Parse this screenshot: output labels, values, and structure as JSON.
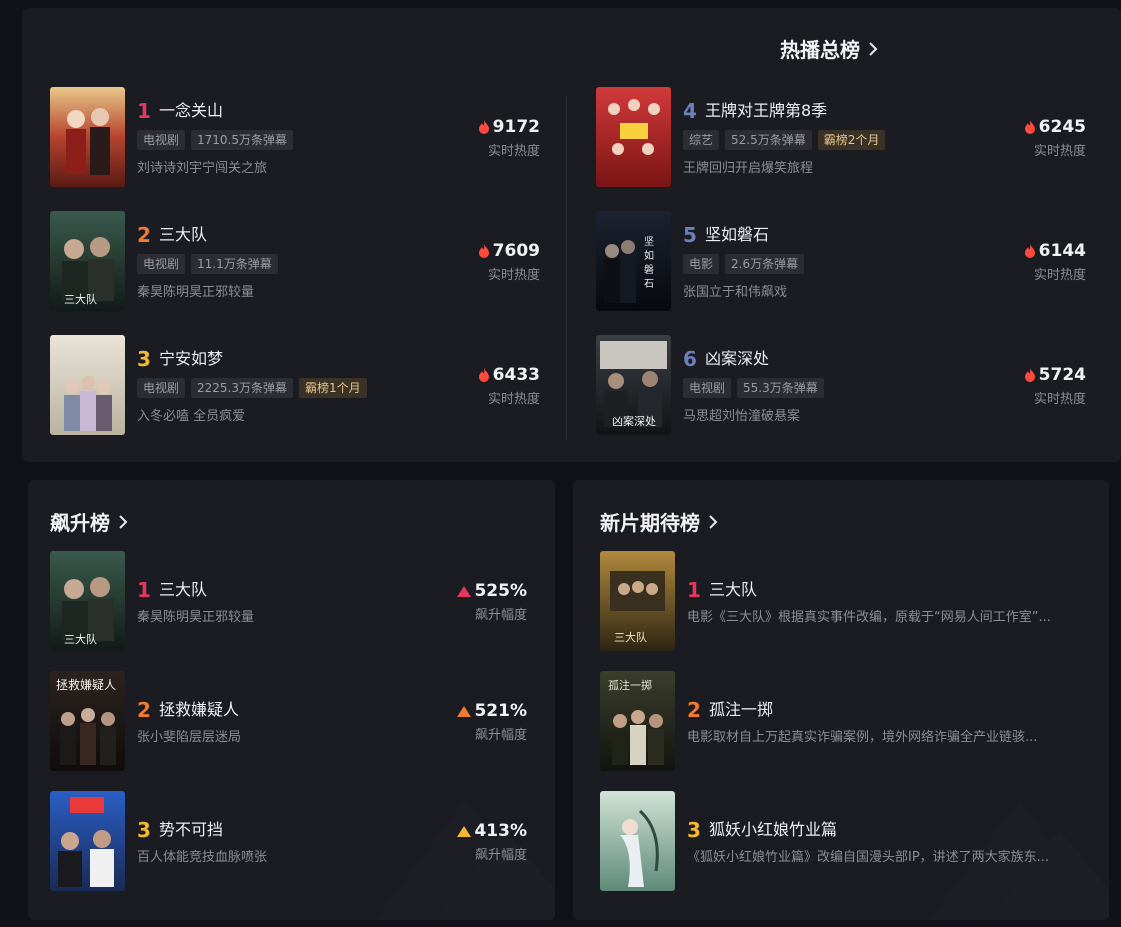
{
  "hot_chart": {
    "title": "热播总榜",
    "items": [
      {
        "rank": "1",
        "name": "一念关山",
        "tags": [
          "电视剧",
          "1710.5万条弹幕"
        ],
        "desc": "刘诗诗刘宇宁闯关之旅",
        "score": "9172",
        "score_label": "实时热度"
      },
      {
        "rank": "2",
        "name": "三大队",
        "tags": [
          "电视剧",
          "11.1万条弹幕"
        ],
        "desc": "秦昊陈明昊正邪较量",
        "score": "7609",
        "score_label": "实时热度"
      },
      {
        "rank": "3",
        "name": "宁安如梦",
        "tags": [
          "电视剧",
          "2225.3万条弹幕",
          "霸榜1个月"
        ],
        "desc": "入冬必嗑 全员疯爱",
        "score": "6433",
        "score_label": "实时热度"
      },
      {
        "rank": "4",
        "name": "王牌对王牌第8季",
        "tags": [
          "综艺",
          "52.5万条弹幕",
          "霸榜2个月"
        ],
        "desc": "王牌回归开启爆笑旅程",
        "score": "6245",
        "score_label": "实时热度"
      },
      {
        "rank": "5",
        "name": "坚如磐石",
        "tags": [
          "电影",
          "2.6万条弹幕"
        ],
        "desc": "张国立于和伟飙戏",
        "score": "6144",
        "score_label": "实时热度"
      },
      {
        "rank": "6",
        "name": "凶案深处",
        "tags": [
          "电视剧",
          "55.3万条弹幕"
        ],
        "desc": "马思超刘怡潼破悬案",
        "score": "5724",
        "score_label": "实时热度"
      }
    ]
  },
  "rise_chart": {
    "title": "飙升榜",
    "items": [
      {
        "rank": "1",
        "name": "三大队",
        "desc": "秦昊陈明昊正邪较量",
        "value": "525%",
        "value_label": "飙升幅度"
      },
      {
        "rank": "2",
        "name": "拯救嫌疑人",
        "desc": "张小斐陷层层迷局",
        "value": "521%",
        "value_label": "飙升幅度"
      },
      {
        "rank": "3",
        "name": "势不可挡",
        "desc": "百人体能竞技血脉喷张",
        "value": "413%",
        "value_label": "飙升幅度"
      }
    ]
  },
  "new_chart": {
    "title": "新片期待榜",
    "items": [
      {
        "rank": "1",
        "name": "三大队",
        "desc": "电影《三大队》根据真实事件改编，原载于“网易人间工作室”..."
      },
      {
        "rank": "2",
        "name": "孤注一掷",
        "desc": "电影取材自上万起真实诈骗案例，境外网络诈骗全产业链骇..."
      },
      {
        "rank": "3",
        "name": "狐妖小红娘竹业篇",
        "desc": "《狐妖小红娘竹业篇》改编自国漫头部IP，讲述了两大家族东..."
      }
    ]
  },
  "colors": {
    "rank1": "#e8365d",
    "rank2": "#f07a2e",
    "rank3": "#f5b82e",
    "rank_other": "#6b7fb8",
    "flame": "#ff4a3d"
  }
}
